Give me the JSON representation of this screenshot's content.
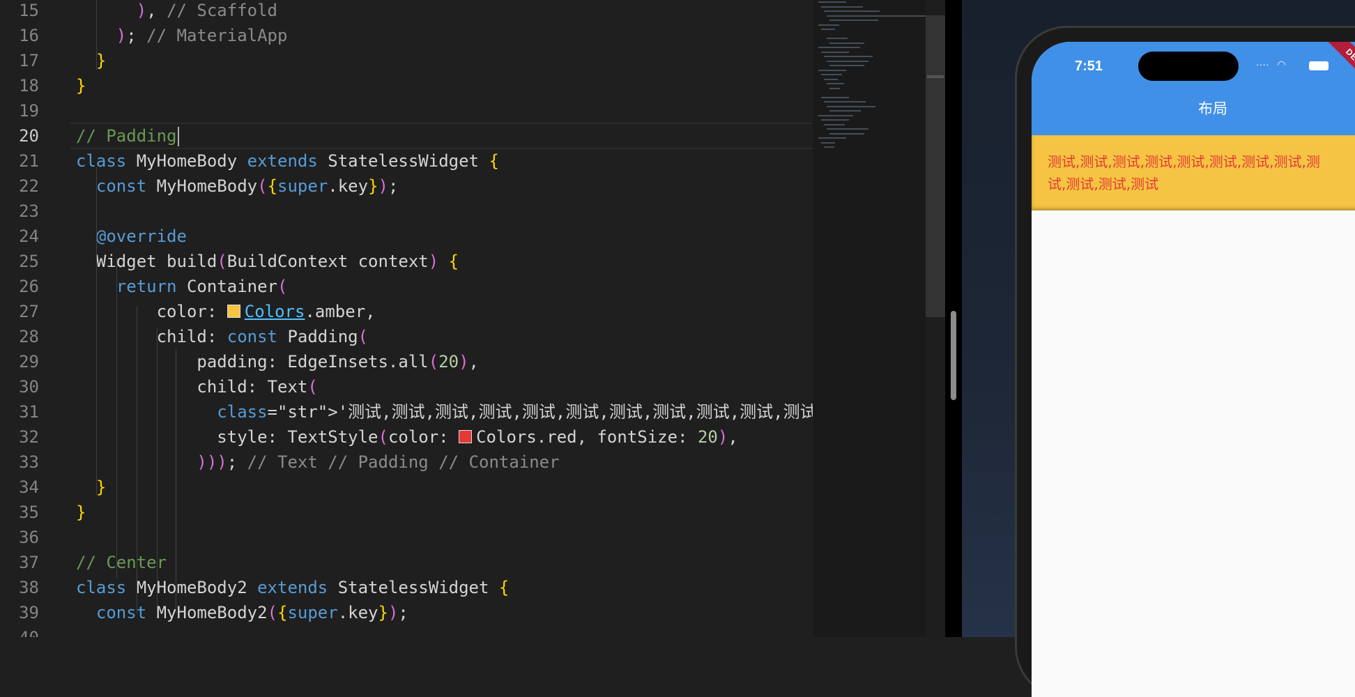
{
  "editor": {
    "active_line": "20",
    "lines": [
      {
        "n": "15",
        "c": "      ), // Scaffold"
      },
      {
        "n": "16",
        "c": "    ); // MaterialApp"
      },
      {
        "n": "17",
        "c": "  }"
      },
      {
        "n": "18",
        "c": "}"
      },
      {
        "n": "19",
        "c": ""
      },
      {
        "n": "20",
        "c": "// Padding"
      },
      {
        "n": "21",
        "c": "class MyHomeBody extends StatelessWidget {"
      },
      {
        "n": "22",
        "c": "  const MyHomeBody({super.key});"
      },
      {
        "n": "23",
        "c": ""
      },
      {
        "n": "24",
        "c": "  @override"
      },
      {
        "n": "25",
        "c": "  Widget build(BuildContext context) {"
      },
      {
        "n": "26",
        "c": "    return Container("
      },
      {
        "n": "27",
        "c": "        color: Colors.amber,"
      },
      {
        "n": "28",
        "c": "        child: const Padding("
      },
      {
        "n": "29",
        "c": "            padding: EdgeInsets.all(20),"
      },
      {
        "n": "30",
        "c": "            child: Text("
      },
      {
        "n": "31",
        "c": "              '测试,测试,测试,测试,测试,测试,测试,测试,测试,测试,测试,测试',"
      },
      {
        "n": "32",
        "c": "              style: TextStyle(color: Colors.red, fontSize: 20),"
      },
      {
        "n": "33",
        "c": "            ))); // Text // Padding // Container"
      },
      {
        "n": "34",
        "c": "  }"
      },
      {
        "n": "35",
        "c": "}"
      },
      {
        "n": "36",
        "c": ""
      },
      {
        "n": "37",
        "c": "// Center"
      },
      {
        "n": "38",
        "c": "class MyHomeBody2 extends StatelessWidget {"
      },
      {
        "n": "39",
        "c": "  const MyHomeBody2({super.key});"
      },
      {
        "n": "40",
        "c": ""
      }
    ],
    "swatch_colors": {
      "amber": "#f5c443",
      "red": "#e53935"
    }
  },
  "simulator": {
    "status_time": "7:51",
    "debug_banner": "DEBUG",
    "app_title": "布局",
    "body_text": "测试,测试,测试,测试,测试,测试,测试,测试,测试,测试,测试,测试",
    "colors": {
      "appbar": "#4090e8",
      "container": "#f5c443",
      "text": "#e53935",
      "background": "#fafafa"
    }
  }
}
